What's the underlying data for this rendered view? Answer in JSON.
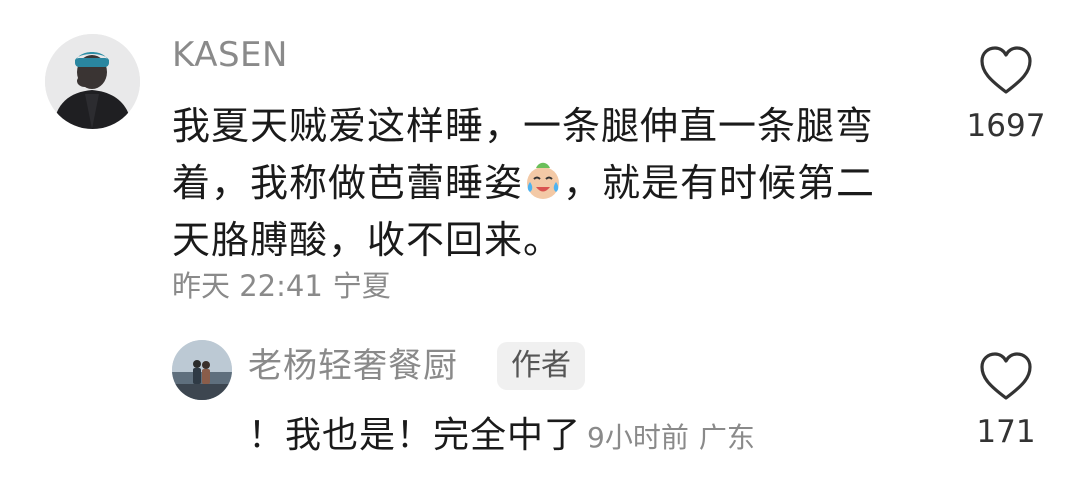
{
  "comment": {
    "username": "KASEN",
    "avatar_icon": "user-avatar-icon",
    "text_part1": "我夏天贼爱这样睡，一条腿伸直一条腿弯着，我称做芭蕾睡姿",
    "emoji_icon": "crying-laughing-emoji-icon",
    "text_part2": "，就是有时候第二天胳膊酸，收不回来。",
    "time": "昨天 22:41",
    "location": "宁夏",
    "like_count": "1697",
    "like_icon": "heart-outline-icon"
  },
  "reply": {
    "username": "老杨轻奢餐厨",
    "avatar_icon": "user-avatar-icon",
    "badge": "作者",
    "text": "！我也是！完全中了",
    "time": "9小时前",
    "location": "广东",
    "like_count": "171",
    "like_icon": "heart-outline-icon"
  },
  "colors": {
    "text_primary": "#1a1a1a",
    "text_secondary": "#8a8a8a",
    "badge_bg": "#f0f0f0"
  }
}
